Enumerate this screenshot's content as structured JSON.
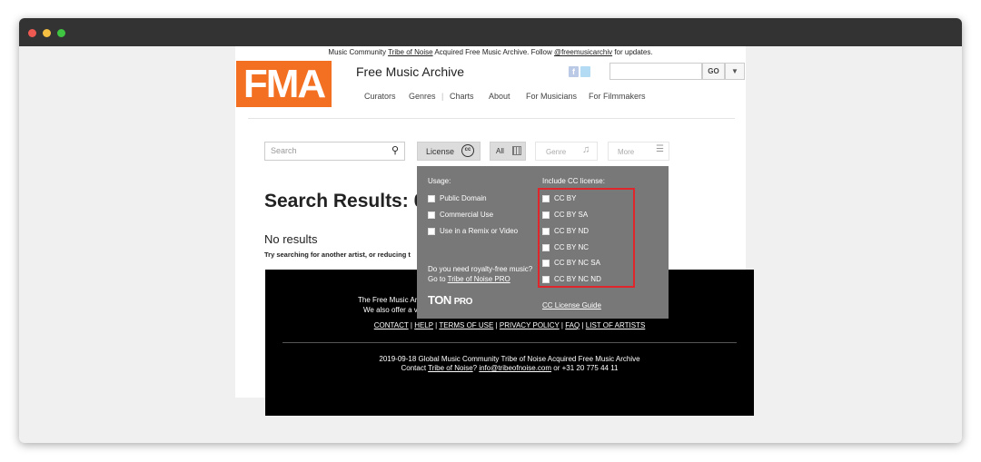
{
  "announcement": {
    "prefix": "Music Community ",
    "link1": "Tribe of Noise",
    "middle": " Acquired Free Music Archive. Follow ",
    "link2": "@freemusicarchiv",
    "suffix": " for updates."
  },
  "header": {
    "logo": "FMA",
    "title": "Free Music Archive",
    "go_label": "GO",
    "dropdown_glyph": "▼",
    "nav": [
      "Curators",
      "Genres",
      "Charts",
      "About",
      "For Musicians",
      "For Filmmakers"
    ]
  },
  "filters": {
    "search_placeholder": "Search",
    "license_label": "License",
    "all_label": "All",
    "genre_label": "Genre",
    "more_label": "More"
  },
  "results": {
    "title": "Search Results: 0 T",
    "no_results": "No results",
    "hint": "Try searching for another artist, or reducing t"
  },
  "license_panel": {
    "usage_label": "Usage:",
    "usage_options": [
      "Public Domain",
      "Commercial Use",
      "Use in a Remix or Video"
    ],
    "include_label": "Include CC license:",
    "cc_options": [
      "CC BY",
      "CC BY SA",
      "CC BY ND",
      "CC BY NC",
      "CC BY NC SA",
      "CC BY NC ND"
    ],
    "royalty_question": "Do you need royalty-free music?",
    "royalty_prefix": "Go to ",
    "royalty_link": "Tribe of Noise PRO",
    "ton_logo": "TON",
    "ton_pro": "PRO",
    "guide_link": "CC License Guide",
    "highlight_color": "#e0262d"
  },
  "footer": {
    "line1": "The Free Music Ar",
    "line2": "We also offer a v",
    "links": [
      "CONTACT",
      "HELP",
      "TERMS OF USE",
      "PRIVACY POLICY",
      "FAQ",
      "LIST OF ARTISTS"
    ],
    "copyright": "2019-09-18 Global Music Community Tribe of Noise Acquired Free Music Archive",
    "contact_prefix": "Contact ",
    "contact_link1": "Tribe of Noise",
    "contact_mid": "? ",
    "contact_email": "info@tribeofnoise.com",
    "contact_suffix": " or +31 20 775 44 11"
  },
  "colors": {
    "brand_orange": "#f36f21",
    "titlebar": "#333333",
    "panel_gray": "#787878"
  }
}
